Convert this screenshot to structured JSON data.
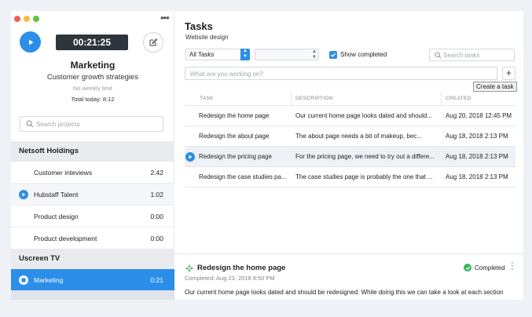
{
  "sidebar": {
    "timer": "00:21:25",
    "project_name": "Marketing",
    "project_subtitle": "Customer growth strategies",
    "weekly_limit": "No weekly limit",
    "total_today": "Total today: 8:12",
    "search_placeholder": "Search projects",
    "groups": [
      {
        "name": "Netsoft Holdings",
        "projects": [
          {
            "label": "Customer inteviews",
            "time": "2:42",
            "icon": "none"
          },
          {
            "label": "Hubstaff Talent",
            "time": "1:02",
            "icon": "play-icon"
          },
          {
            "label": "Product design",
            "time": "0:00",
            "icon": "none"
          },
          {
            "label": "Product development",
            "time": "0:00",
            "icon": "none"
          }
        ]
      },
      {
        "name": "Uscreen TV",
        "projects": [
          {
            "label": "Marketing",
            "time": "0:21",
            "icon": "stop-icon",
            "active": true
          }
        ]
      }
    ]
  },
  "main": {
    "title": "Tasks",
    "subtitle": "Website design",
    "filter_select": "All Tasks",
    "show_completed_label": "Show completed",
    "show_completed_checked": true,
    "search_placeholder": "Search tasks",
    "working_placeholder": "What are you working on?",
    "add_button_label": "+",
    "tooltip": "Create a task",
    "columns": [
      "TASK",
      "DESCRIPTION",
      "CREATED"
    ],
    "tasks": [
      {
        "task": "Redesign the home page",
        "description": "Our current home page looks dated and should...",
        "created": "Aug 20, 2018 12:45 PM"
      },
      {
        "task": "Redesign the about page",
        "description": "The about page needs a bit of makeup, bec...",
        "created": "Aug 18, 2018 2:13 PM"
      },
      {
        "task": "Redesign the pricing page",
        "description": "For the pricing page, we need to try out a differe...",
        "created": "Aug 18, 2018 2:13 PM",
        "selected": true
      },
      {
        "task": "Redesign the case studies pa...",
        "description": "The case studies page is probably the one that ...",
        "created": "Aug 18, 2018 2:13 PM"
      }
    ],
    "detail": {
      "title": "Redesign the home page",
      "completed_date": "Completed: Aug 23, 2018 8:50 PM",
      "status": "Completed",
      "description": "Our current home page looks dated and should be redesigned. While doing this we can take a look at each section"
    }
  },
  "colors": {
    "accent": "#2c8ee8",
    "timer_bg": "#2f353d",
    "completed_green": "#3cb65c"
  }
}
